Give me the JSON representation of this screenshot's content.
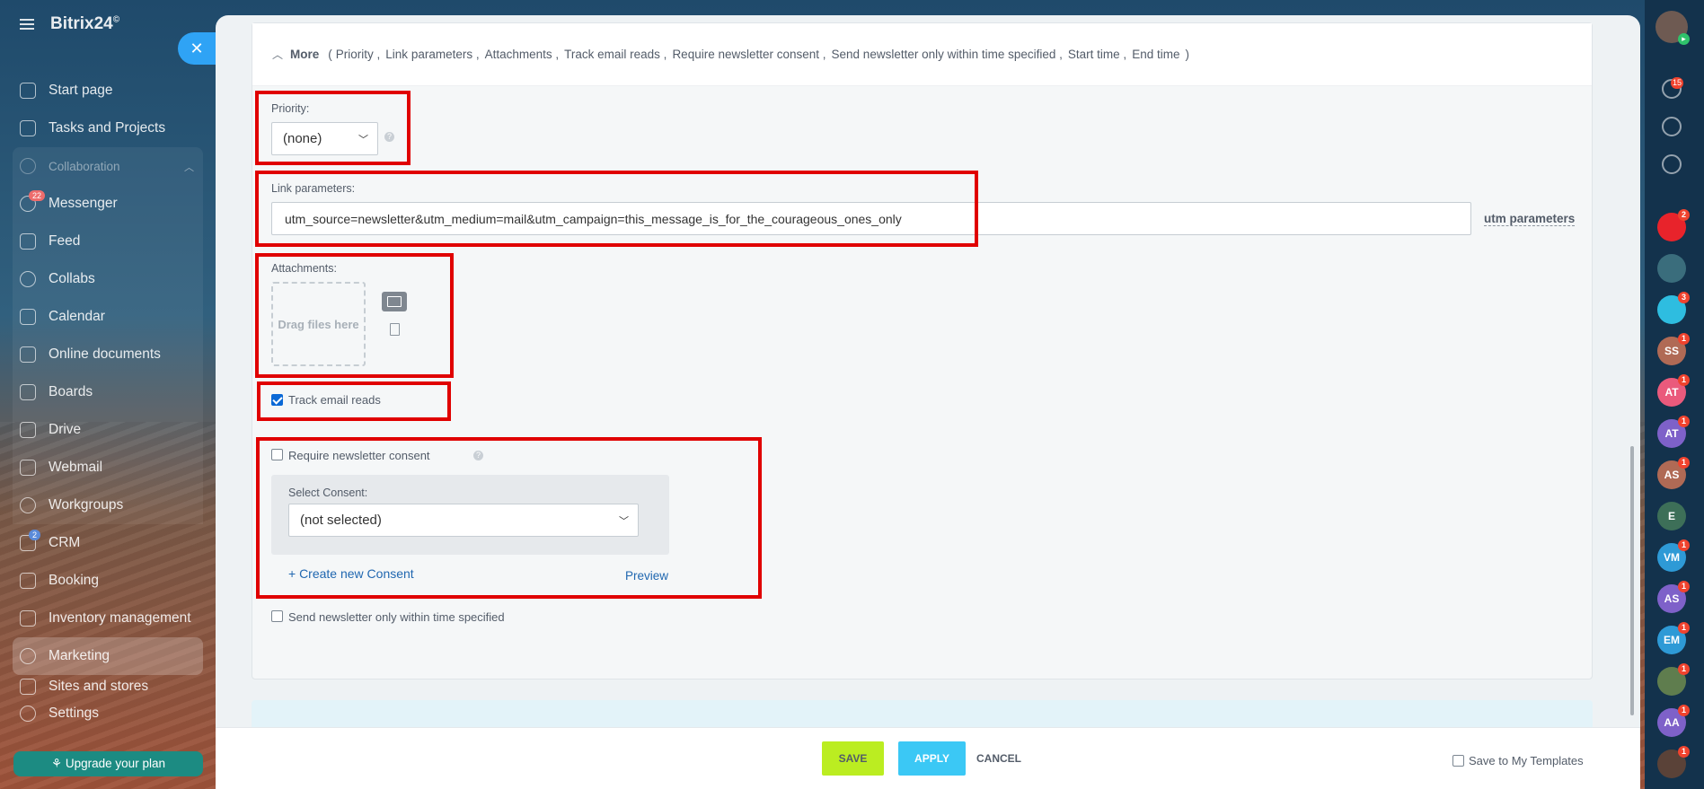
{
  "app": {
    "logo": "Bitrix24",
    "logo_mark": "©"
  },
  "sidebar": {
    "items": [
      {
        "label": "Start page"
      },
      {
        "label": "Tasks and Projects"
      },
      {
        "label": "Collaboration"
      },
      {
        "label": "Messenger",
        "badge": "22"
      },
      {
        "label": "Feed"
      },
      {
        "label": "Collabs"
      },
      {
        "label": "Calendar"
      },
      {
        "label": "Online documents"
      },
      {
        "label": "Boards"
      },
      {
        "label": "Drive"
      },
      {
        "label": "Webmail"
      },
      {
        "label": "Workgroups"
      },
      {
        "label": "CRM",
        "badge": "2"
      },
      {
        "label": "Booking"
      },
      {
        "label": "Inventory management"
      },
      {
        "label": "Marketing"
      },
      {
        "label": "Sites and stores"
      },
      {
        "label": "Settings"
      }
    ],
    "upgrade_label": "Upgrade your plan"
  },
  "more": {
    "label": "More",
    "items_open": "(",
    "items_close": ")",
    "items": [
      "Priority ,",
      "Link parameters ,",
      "Attachments ,",
      "Track email reads ,",
      "Require newsletter consent ,",
      "Send newsletter only within time specified ,",
      "Start time ,",
      "End time"
    ]
  },
  "form": {
    "priority_label": "Priority:",
    "priority_value": "(none)",
    "link_params_label": "Link parameters:",
    "link_params_value": "utm_source=newsletter&utm_medium=mail&utm_campaign=this_message_is_for_the_courageous_ones_only",
    "utm_link": "utm parameters",
    "attachments_label": "Attachments:",
    "dropzone_text": "Drag files here",
    "track_reads_label": "Track email reads",
    "track_reads_checked": true,
    "consent_label": "Require newsletter consent",
    "select_consent_label": "Select Consent:",
    "select_consent_value": "(not selected)",
    "create_consent_link": "+ Create new Consent",
    "preview_link": "Preview",
    "time_specified_label": "Send newsletter only within time specified"
  },
  "footer": {
    "save": "SAVE",
    "apply": "APPLY",
    "cancel": "CANCEL",
    "save_template": "Save to My Templates"
  },
  "rail": {
    "top_badge": "15",
    "notif_badge": "15",
    "avatars": [
      {
        "initials": "",
        "count": "2",
        "color": "#e8232b"
      },
      {
        "initials": "",
        "count": "",
        "color": "#3a6d7c"
      },
      {
        "initials": "",
        "count": "3",
        "color": "#2ebde0"
      },
      {
        "initials": "SS",
        "count": "1",
        "color": "#b06a55"
      },
      {
        "initials": "AT",
        "count": "1",
        "color": "#ea5a7c"
      },
      {
        "initials": "AT",
        "count": "1",
        "color": "#7e61c9"
      },
      {
        "initials": "AS",
        "count": "1",
        "color": "#b06a55"
      },
      {
        "initials": "E",
        "count": "",
        "color": "#3d6f58"
      },
      {
        "initials": "VM",
        "count": "1",
        "color": "#2e9ad6"
      },
      {
        "initials": "AS",
        "count": "1",
        "color": "#7e61c9"
      },
      {
        "initials": "EM",
        "count": "1",
        "color": "#2e9ad6"
      },
      {
        "initials": "",
        "count": "1",
        "color": "#5f7d4e"
      },
      {
        "initials": "AA",
        "count": "1",
        "color": "#7e61c9"
      },
      {
        "initials": "",
        "count": "1",
        "color": "#5a4238"
      }
    ]
  }
}
